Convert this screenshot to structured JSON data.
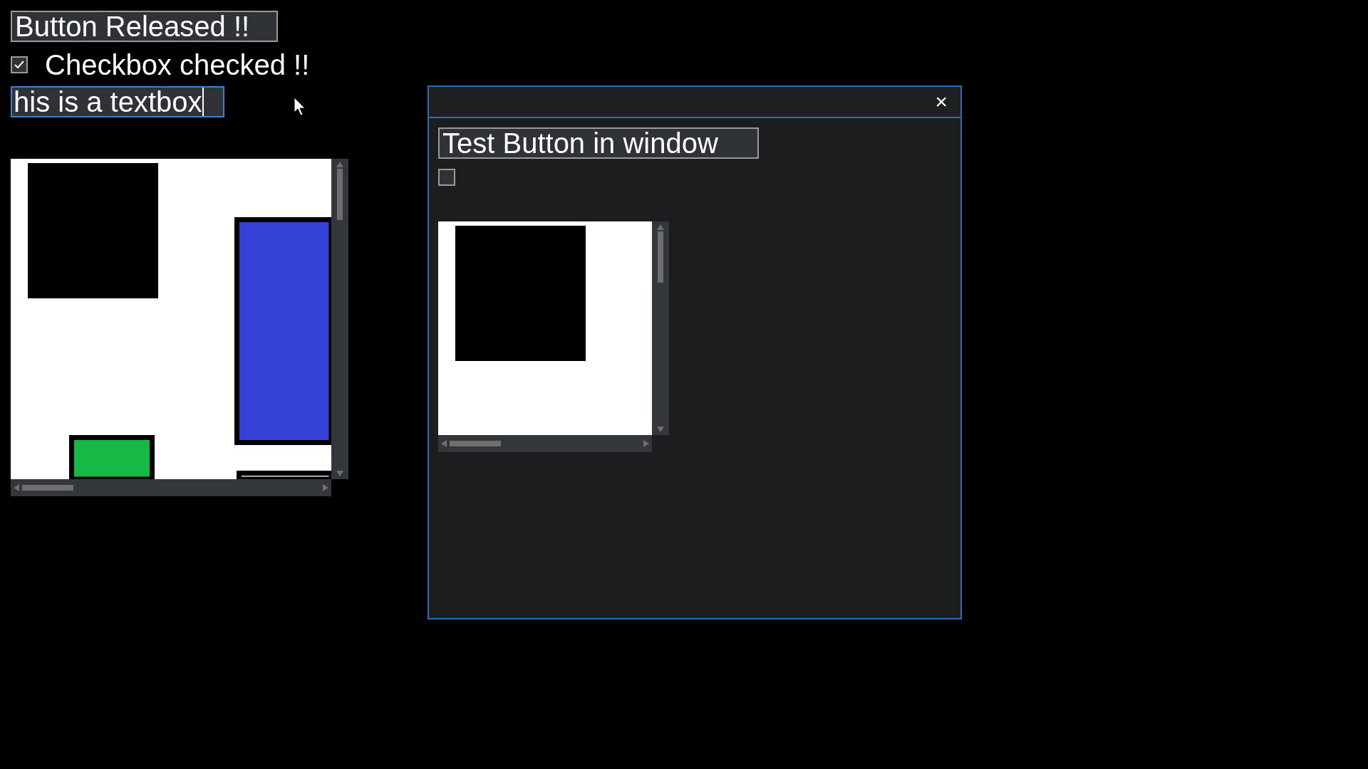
{
  "button": {
    "label": "Button Released !!"
  },
  "checkbox": {
    "label": "Checkbox checked !!",
    "checked": true
  },
  "textbox": {
    "value": "his is a textbox",
    "focused": true
  },
  "canvas": {
    "shapes": [
      {
        "kind": "plain",
        "color": "#000000"
      },
      {
        "kind": "outlined",
        "color": "#3540d6"
      },
      {
        "kind": "outlined",
        "color": "#17b845"
      },
      {
        "kind": "outlined",
        "color": "#e2defa"
      }
    ]
  },
  "window": {
    "close": "×",
    "button": {
      "label": "Test Button in window"
    },
    "checkbox": {
      "checked": false
    },
    "canvas": {
      "shapes": [
        {
          "kind": "plain",
          "color": "#000000"
        }
      ]
    }
  }
}
